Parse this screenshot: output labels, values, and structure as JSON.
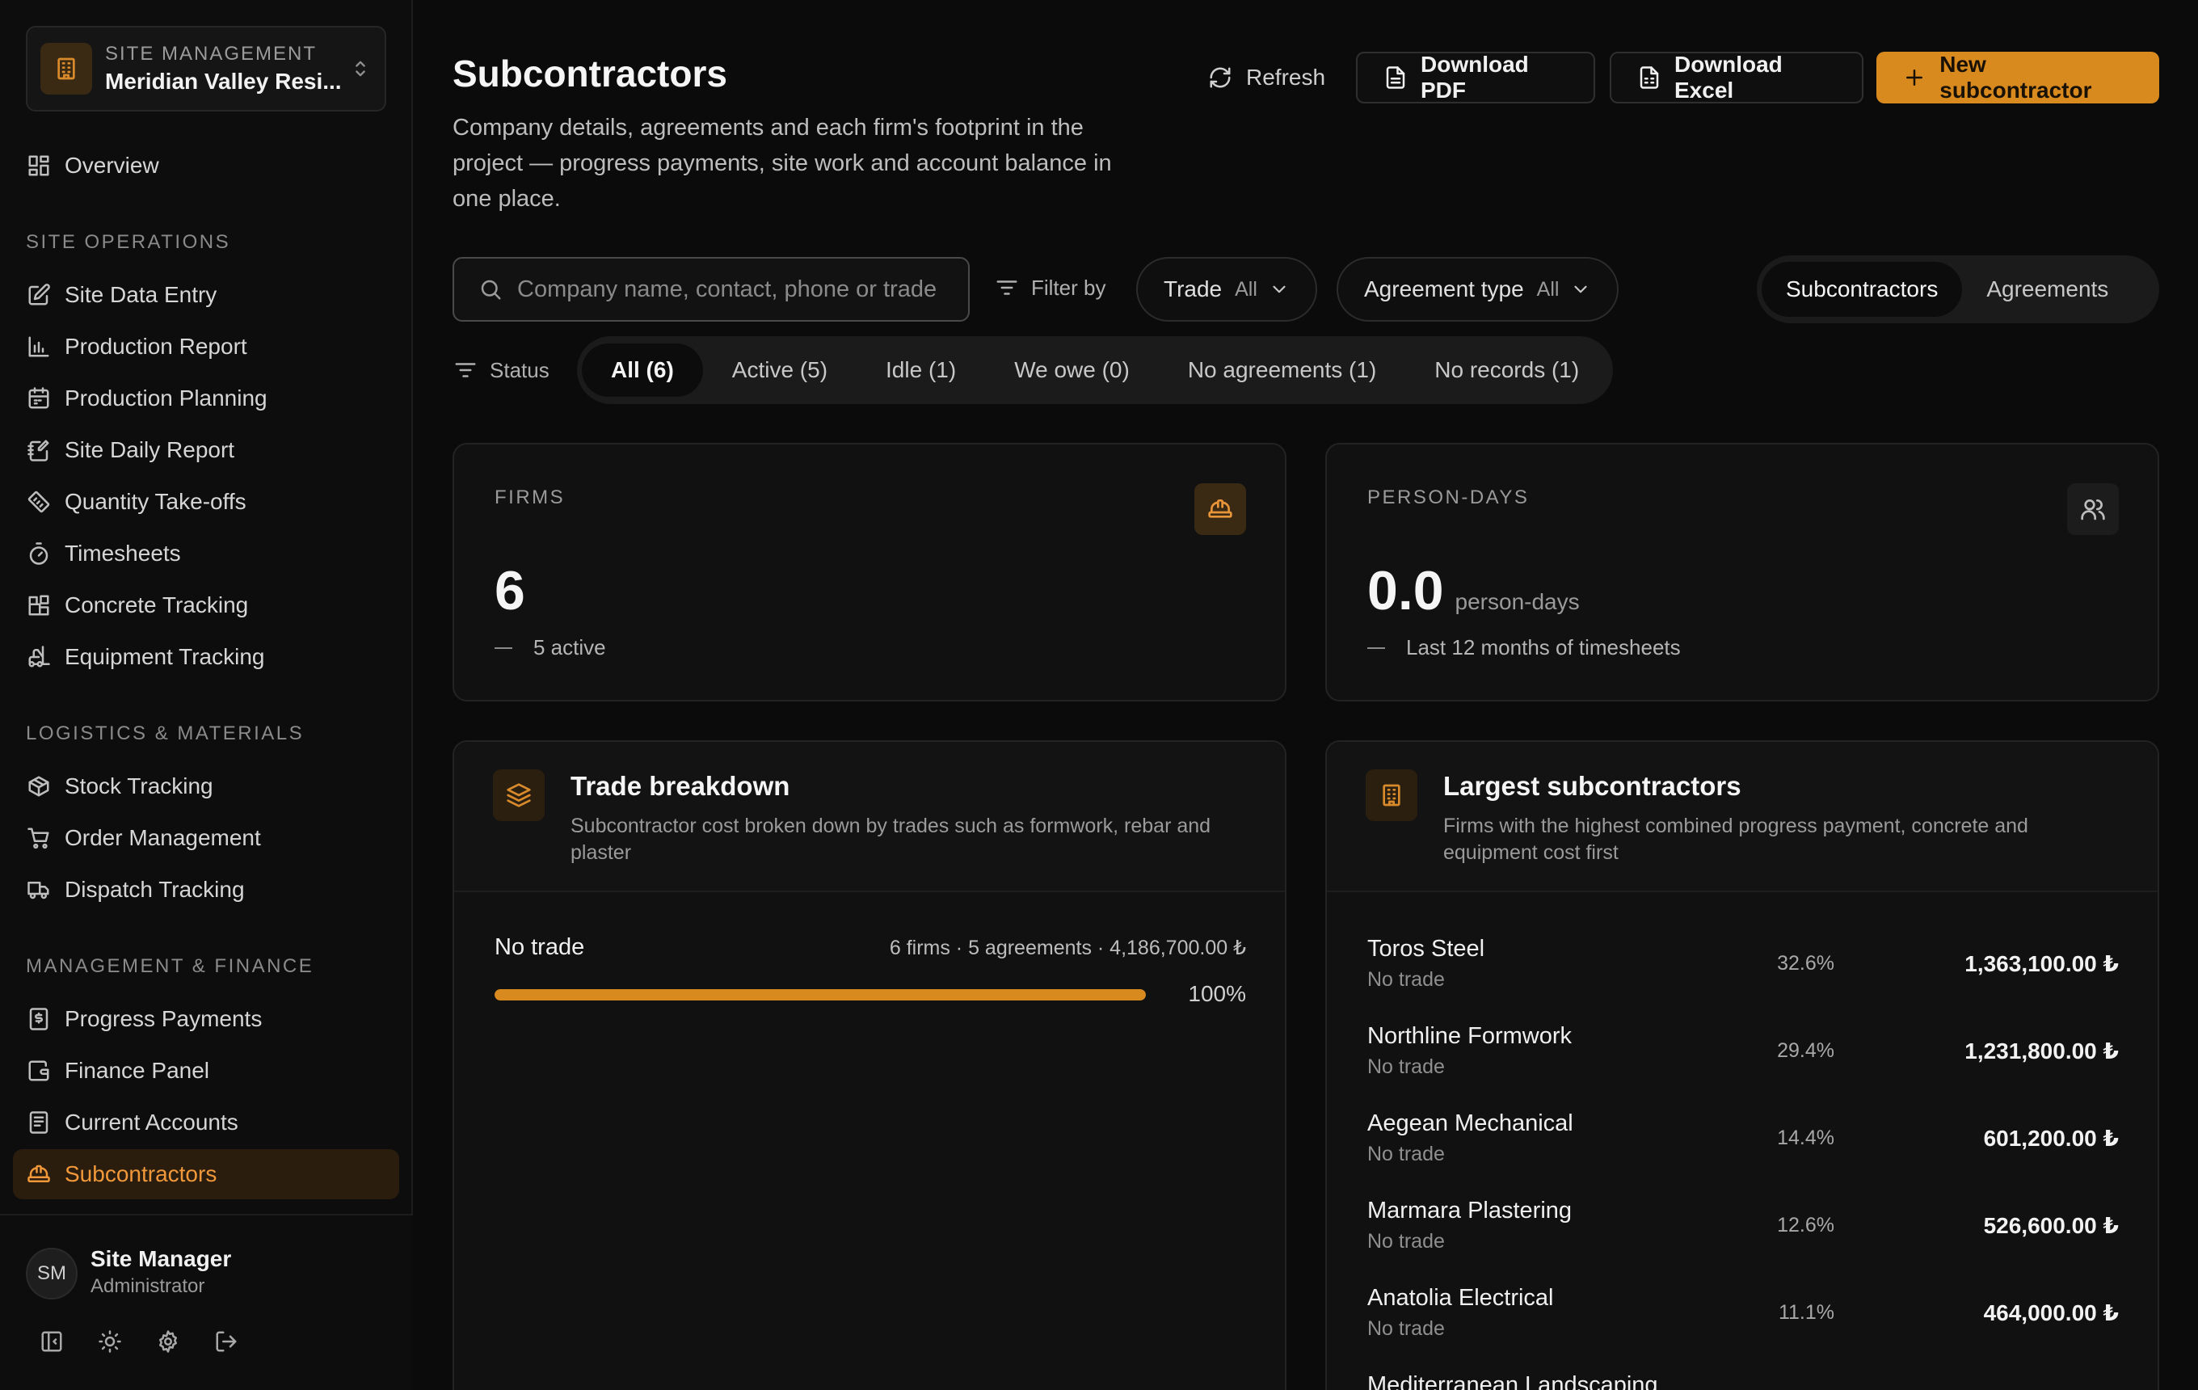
{
  "site": {
    "caption": "SITE MANAGEMENT",
    "name": "Meridian Valley Resi..."
  },
  "nav": {
    "overview": "Overview",
    "sections": {
      "site_ops": "SITE OPERATIONS",
      "logistics": "LOGISTICS & MATERIALS",
      "management": "MANAGEMENT & FINANCE"
    },
    "site_ops": [
      "Site Data Entry",
      "Production Report",
      "Production Planning",
      "Site Daily Report",
      "Quantity Take-offs",
      "Timesheets",
      "Concrete Tracking",
      "Equipment Tracking"
    ],
    "logistics": [
      "Stock Tracking",
      "Order Management",
      "Dispatch Tracking"
    ],
    "management": [
      "Progress Payments",
      "Finance Panel",
      "Current Accounts",
      "Subcontractors"
    ]
  },
  "user": {
    "initials": "SM",
    "name": "Site Manager",
    "role": "Administrator"
  },
  "header": {
    "title": "Subcontractors",
    "description": "Company details, agreements and each firm's footprint in the project — progress payments, site work and account balance in one place.",
    "refresh": "Refresh",
    "download_pdf": "Download PDF",
    "download_excel": "Download Excel",
    "new_sub": "New subcontractor"
  },
  "filters": {
    "search_placeholder": "Company name, contact, phone or trade",
    "filter_by": "Filter by",
    "trade_label": "Trade",
    "trade_value": "All",
    "agreement_label": "Agreement type",
    "agreement_value": "All",
    "status_label": "Status",
    "status_chips": [
      "All (6)",
      "Active (5)",
      "Idle (1)",
      "We owe (0)",
      "No agreements (1)",
      "No records (1)"
    ],
    "active_status": 0
  },
  "view_toggle": {
    "options": [
      "Subcontractors",
      "Agreements"
    ],
    "selected": 0
  },
  "kpis": {
    "firms": {
      "caption": "FIRMS",
      "value": "6",
      "sub": "5 active"
    },
    "person_days": {
      "caption": "PERSON-DAYS",
      "value": "0.0",
      "unit": "person-days",
      "sub": "Last 12 months of timesheets"
    }
  },
  "trade_breakdown": {
    "title": "Trade breakdown",
    "subtitle": "Subcontractor cost broken down by trades such as formwork, rebar and plaster",
    "rows": [
      {
        "name": "No trade",
        "meta": "6 firms · 5 agreements · 4,186,700.00 ₺",
        "percent_label": "100%",
        "fraction": 1.0
      }
    ]
  },
  "largest": {
    "title": "Largest subcontractors",
    "subtitle": "Firms with the highest combined progress payment, concrete and equipment cost first",
    "rows": [
      {
        "name": "Toros Steel",
        "trade": "No trade",
        "pct": "32.6%",
        "amount": "1,363,100.00 ₺"
      },
      {
        "name": "Northline Formwork",
        "trade": "No trade",
        "pct": "29.4%",
        "amount": "1,231,800.00 ₺"
      },
      {
        "name": "Aegean Mechanical",
        "trade": "No trade",
        "pct": "14.4%",
        "amount": "601,200.00 ₺"
      },
      {
        "name": "Marmara Plastering",
        "trade": "No trade",
        "pct": "12.6%",
        "amount": "526,600.00 ₺"
      },
      {
        "name": "Anatolia Electrical",
        "trade": "No trade",
        "pct": "11.1%",
        "amount": "464,000.00 ₺"
      },
      {
        "name": "Mediterranean Landscaping",
        "trade": "",
        "pct": "",
        "amount": ""
      }
    ]
  },
  "colors": {
    "accent": "#d98a1f",
    "background": "#0b0b0b",
    "card": "#111111"
  }
}
